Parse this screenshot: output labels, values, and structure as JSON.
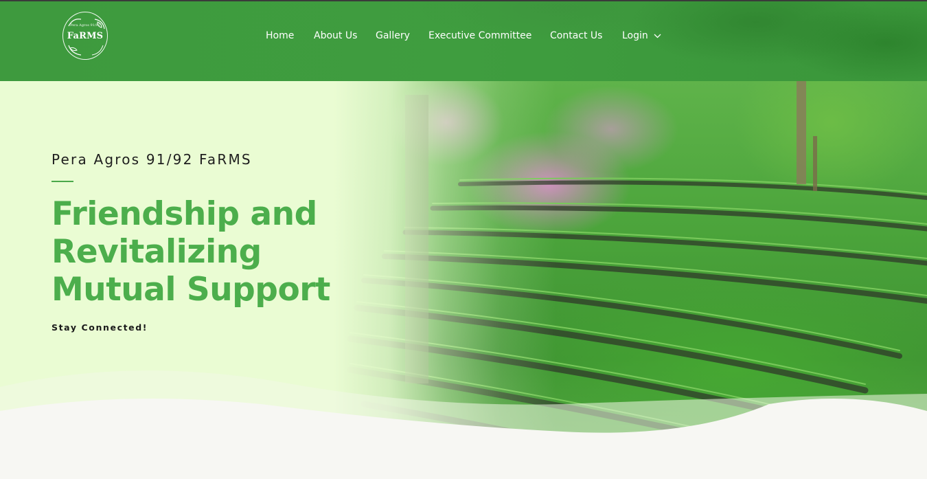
{
  "brand": {
    "logo_text": "FaRMS",
    "logo_small_text": "Pera Agros 91/92"
  },
  "nav": {
    "items": [
      {
        "label": "Home"
      },
      {
        "label": "About Us"
      },
      {
        "label": "Gallery"
      },
      {
        "label": "Executive Committee"
      },
      {
        "label": "Contact Us"
      },
      {
        "label": "Login"
      }
    ],
    "login_icon": "chevron-down-icon"
  },
  "hero": {
    "kicker": "Pera Agros 91/92 FaRMS",
    "headline": "Friendship and Revitalizing Mutual Support",
    "tagline": "Stay Connected!"
  },
  "colors": {
    "header_green": "#3f9d3f",
    "headline_green": "#4cae4c",
    "hero_background": "#e9fbd0",
    "page_background": "#f7f7f3"
  }
}
